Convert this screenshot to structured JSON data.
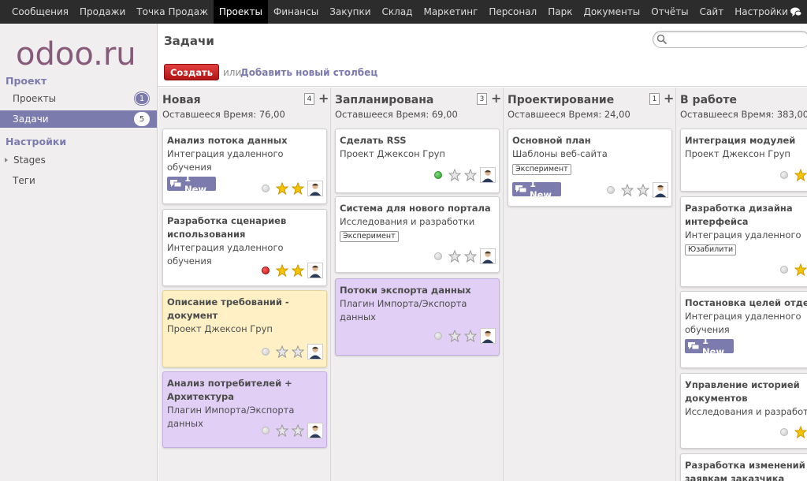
{
  "topmenu": [
    "Сообщения",
    "Продажи",
    "Точка Продаж",
    "Проекты",
    "Финансы",
    "Закупки",
    "Склад",
    "Маркетинг",
    "Персонал",
    "Парк",
    "Документы",
    "Отчёты",
    "Сайт",
    "Настройки"
  ],
  "topmenu_active": "Проекты",
  "logo_text": "odoo.ru",
  "sidebar": {
    "section_project": "Проект",
    "projects_label": "Проекты",
    "projects_count": "1",
    "tasks_label": "Задачи",
    "tasks_count": "5",
    "section_settings": "Настройки",
    "stages_label": "Stages",
    "tags_label": "Теги"
  },
  "header": {
    "title": "Задачи",
    "search_placeholder": "",
    "create_label": "Создать",
    "or_label": "или",
    "add_column_label": "Добавить новый столбец"
  },
  "columns": [
    {
      "title": "Новая",
      "count": "4",
      "remaining": "Оставшееся Время: 76,00",
      "cards": [
        {
          "title": "Анализ потока данных",
          "subtitle": "Интеграция удаленного обучения",
          "badge": "1 New",
          "status": "grey",
          "stars": 2
        },
        {
          "title": "Разработка сценариев использования",
          "subtitle": "Интеграция удаленного обучения",
          "status": "red",
          "stars": 2
        },
        {
          "title": "Описание требований - документ",
          "subtitle": "Проект Джексон Груп",
          "status": "grey",
          "stars": 0,
          "color": "yellow"
        },
        {
          "title": "Анализ потребителей + Архитектура",
          "subtitle": "Плагин Импорта/Экспорта данных",
          "status": "grey",
          "stars": 0,
          "color": "purple"
        }
      ]
    },
    {
      "title": "Запланирована",
      "count": "3",
      "remaining": "Оставшееся Время: 69,00",
      "cards": [
        {
          "title": "Сделать RSS",
          "subtitle": "Проект Джексон Груп",
          "status": "green",
          "stars": 0
        },
        {
          "title": "Система для нового портала",
          "subtitle": "Исследования и разработки",
          "tag": "Эксперимент",
          "status": "grey",
          "stars": 0
        },
        {
          "title": "Потоки экспорта данных",
          "subtitle": "Плагин Импорта/Экспорта данных",
          "status": "grey",
          "stars": 0,
          "color": "purple"
        }
      ]
    },
    {
      "title": "Проектирование",
      "count": "1",
      "remaining": "Оставшееся Время: 24,00",
      "cards": [
        {
          "title": "Основной план",
          "subtitle": "Шаблоны веб-сайта",
          "tag": "Эксперимент",
          "badge": "1 New",
          "status": "grey",
          "stars": 0
        }
      ]
    },
    {
      "title": "В работе",
      "remaining": "Оставшееся Время: 383,00",
      "cards": [
        {
          "title": "Интеграция модулей",
          "subtitle": "Проект Джексон Груп",
          "status": "grey",
          "stars": 1
        },
        {
          "title": "Разработка дизайна интерфейса",
          "subtitle": "Интеграция удаленного обучения",
          "tag": "Юзабилити",
          "status": "grey",
          "stars": 1
        },
        {
          "title": "Постановка целей отделам",
          "subtitle": "Интеграция удаленного обучения",
          "badge": "1 New",
          "status": "grey",
          "stars": 1
        },
        {
          "title": "Управление историей документов",
          "subtitle": "Исследования и разработки",
          "status": "grey",
          "stars": 1
        },
        {
          "title": "Разработка изменений по заявкам заказчика",
          "subtitle": "",
          "status": "grey",
          "stars": 0
        }
      ]
    }
  ],
  "colors": {
    "accent": "#7c7bad",
    "create_button": "#c41c1c",
    "topbar": "#2c2c2c",
    "star_yellow": "#f5c400"
  }
}
